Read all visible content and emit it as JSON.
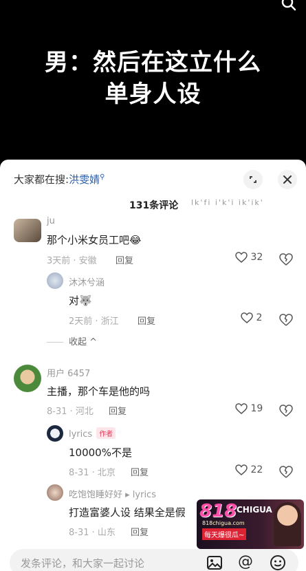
{
  "video": {
    "caption_line1": "男：然后在这立什么",
    "caption_line2": "单身人设",
    "search_icon": "search-icon"
  },
  "panel": {
    "search_prefix": "大家都在搜:",
    "search_keyword": "洪雯婧",
    "comment_count": "131条评论",
    "count_blurred": "lk'fi  i'k'i  ik'ik'"
  },
  "comments": [
    {
      "name": "ju",
      "text": "那个小米女员工吧😂",
      "meta": "3天前 · 安徽",
      "reply": "回复",
      "likes": "32"
    },
    {
      "name": "沐沐兮涵",
      "text": "对🐺",
      "meta": "2天前 · 浙江",
      "reply": "回复",
      "likes": "2"
    },
    {
      "name": "用户 6457",
      "text": "主播，那个车是他的吗",
      "meta": "8-31 · 河北",
      "reply": "回复",
      "likes": "19"
    },
    {
      "name": "lyrics",
      "author_tag": "作者",
      "text": "10000%不是",
      "meta": "8-31 · 北京",
      "reply": "回复",
      "likes": "22"
    },
    {
      "name": "吃饱饱睡好好 ▸ lyrics",
      "text": "打造富婆人设 结果全是假",
      "meta": "8-31 · 山东",
      "reply": "回复"
    }
  ],
  "collapse_label": "收起 ^",
  "input": {
    "placeholder": "发条评论，和大家一起讨论"
  },
  "watermark": {
    "brand": "818",
    "brand_suffix": "CHIGUA",
    "site": "818chigua.com",
    "slogan": "每天爆很瓜~"
  }
}
